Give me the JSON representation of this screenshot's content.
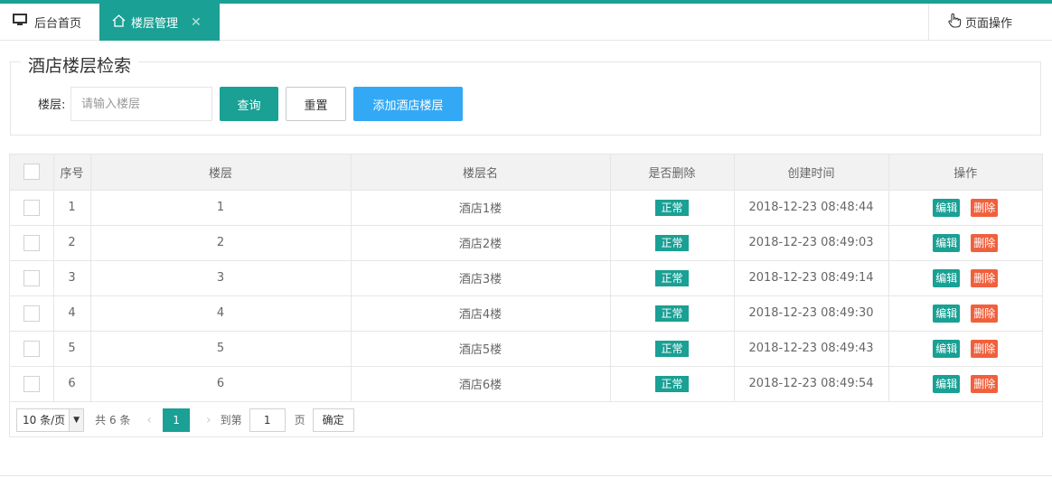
{
  "colors": {
    "accent": "#1aa094",
    "add_button": "#33a9f5",
    "delete_button": "#f0603d"
  },
  "tabs": {
    "home_label": "后台首页",
    "home_icon": "monitor-icon",
    "active_label": "楼层管理",
    "active_icon": "home-icon",
    "close_glyph": "✕",
    "page_ops_label": "页面操作",
    "page_ops_icon": "hand-pointer-icon"
  },
  "search": {
    "legend": "酒店楼层检索",
    "floor_label": "楼层:",
    "floor_placeholder": "请输入楼层",
    "query_label": "查询",
    "reset_label": "重置",
    "add_label": "添加酒店楼层"
  },
  "table": {
    "columns": [
      "序号",
      "楼层",
      "楼层名",
      "是否删除",
      "创建时间",
      "操作"
    ],
    "rows": [
      {
        "seq": "1",
        "floor": "1",
        "name": "酒店1楼",
        "status": "正常",
        "created": "2018-12-23 08:48:44"
      },
      {
        "seq": "2",
        "floor": "2",
        "name": "酒店2楼",
        "status": "正常",
        "created": "2018-12-23 08:49:03"
      },
      {
        "seq": "3",
        "floor": "3",
        "name": "酒店3楼",
        "status": "正常",
        "created": "2018-12-23 08:49:14"
      },
      {
        "seq": "4",
        "floor": "4",
        "name": "酒店4楼",
        "status": "正常",
        "created": "2018-12-23 08:49:30"
      },
      {
        "seq": "5",
        "floor": "5",
        "name": "酒店5楼",
        "status": "正常",
        "created": "2018-12-23 08:49:43"
      },
      {
        "seq": "6",
        "floor": "6",
        "name": "酒店6楼",
        "status": "正常",
        "created": "2018-12-23 08:49:54"
      }
    ],
    "edit_label": "编辑",
    "delete_label": "删除"
  },
  "pager": {
    "limit": "10 条/页",
    "total": "共 6 条",
    "prev": "‹",
    "current": "1",
    "next": "›",
    "goto_label": "到第",
    "goto_value": "1",
    "page_unit": "页",
    "confirm": "确定"
  }
}
